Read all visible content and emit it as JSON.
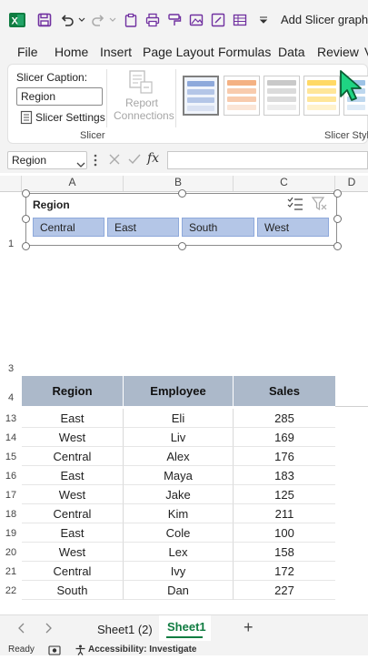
{
  "app": {
    "title": "Add Slicer graphs",
    "brand_color": "#107c41"
  },
  "menu": [
    "File",
    "Home",
    "Insert",
    "Page Layout",
    "Formulas",
    "Data",
    "Review",
    "V"
  ],
  "ribbon": {
    "slicer_caption_label": "Slicer Caption:",
    "caption_value": "Region",
    "slicer_settings": "Slicer Settings",
    "report_connections_line1": "Report",
    "report_connections_line2": "Connections",
    "group_slicer": "Slicer",
    "group_slicer_styles": "Slicer Styles"
  },
  "formula_bar": {
    "name_box": "Region",
    "fx": "fx",
    "formula": ""
  },
  "columns": [
    "A",
    "B",
    "C",
    "D"
  ],
  "top_rows": [
    "1",
    "3",
    "4"
  ],
  "slicer": {
    "title": "Region",
    "items": [
      "Central",
      "East",
      "South",
      "West"
    ],
    "fill_color": "#b4c6e7"
  },
  "table": {
    "headers": [
      "Region",
      "Employee",
      "Sales"
    ],
    "header_color": "#acb9ca",
    "rows": [
      {
        "row": "13",
        "region": "East",
        "employee": "Eli",
        "sales": "285"
      },
      {
        "row": "14",
        "region": "West",
        "employee": "Liv",
        "sales": "169"
      },
      {
        "row": "15",
        "region": "Central",
        "employee": "Alex",
        "sales": "176"
      },
      {
        "row": "16",
        "region": "East",
        "employee": "Maya",
        "sales": "183"
      },
      {
        "row": "17",
        "region": "West",
        "employee": "Jake",
        "sales": "125"
      },
      {
        "row": "18",
        "region": "Central",
        "employee": "Kim",
        "sales": "211"
      },
      {
        "row": "19",
        "region": "East",
        "employee": "Cole",
        "sales": "100"
      },
      {
        "row": "20",
        "region": "West",
        "employee": "Lex",
        "sales": "158"
      },
      {
        "row": "21",
        "region": "Central",
        "employee": "Ivy",
        "sales": "172"
      },
      {
        "row": "22",
        "region": "South",
        "employee": "Dan",
        "sales": "227"
      }
    ]
  },
  "sheets": {
    "tabs": [
      "Sheet1 (2)",
      "Sheet1"
    ],
    "active": "Sheet1",
    "add": "+"
  },
  "status": {
    "ready": "Ready",
    "accessibility": "Accessibility: Investigate"
  }
}
